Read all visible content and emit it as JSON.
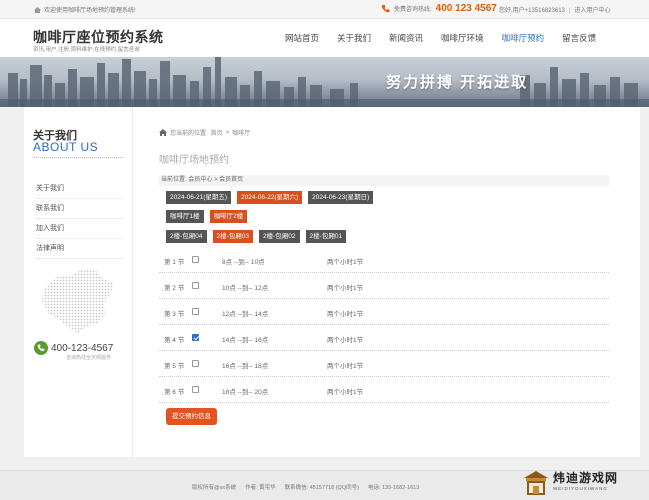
{
  "topbar": {
    "welcome": "欢迎使用咖啡厅场地预约管理系统!",
    "hotline_label": "免费咨询热线:",
    "hotline_number": "400 123 4567",
    "user_text": "您好,用户+13516823613",
    "user_links": "进入用户中心"
  },
  "header": {
    "title": "咖啡厅座位预约系统",
    "subtitle": "资讯,用户,注册,资料维护,在线预约,留言咨询",
    "nav": [
      {
        "label": "网站首页",
        "active": false
      },
      {
        "label": "关于我们",
        "active": false
      },
      {
        "label": "新闻资讯",
        "active": false
      },
      {
        "label": "咖啡厅环境",
        "active": false
      },
      {
        "label": "咖啡厅预约",
        "active": true
      },
      {
        "label": "留言反馈",
        "active": false
      }
    ]
  },
  "banner": {
    "slogan": "努力拼搏 开拓进取"
  },
  "sidebar": {
    "title_cn": "关于我们",
    "title_en": "ABOUT US",
    "menu": [
      "关于我们",
      "联系我们",
      "加入我们",
      "法律声明"
    ],
    "phone": "400-123-4567",
    "phone_caption": "咨询热线全天候服务"
  },
  "main": {
    "breadcrumb": [
      "您当前的位置:",
      "首页",
      ">",
      "咖啡厅"
    ],
    "page_title": "咖啡厅场地预约",
    "location": "当前位置:  会员中心  >  会员首页",
    "dates": [
      {
        "label": "2024-06-21(星期五)",
        "selected": false
      },
      {
        "label": "2024-06-22(星期六)",
        "selected": true
      },
      {
        "label": "2024-06-23(星期日)",
        "selected": false
      }
    ],
    "halls": [
      {
        "label": "咖啡厅1楼",
        "selected": false
      },
      {
        "label": "咖啡厅2楼",
        "selected": true
      }
    ],
    "rooms": [
      {
        "label": "2楼-包厢04",
        "selected": false
      },
      {
        "label": "2楼-包厢03",
        "selected": true
      },
      {
        "label": "2楼-包厢02",
        "selected": false
      },
      {
        "label": "2楼-包厢01",
        "selected": false
      }
    ],
    "slots": [
      {
        "name": "第 1 节",
        "time": "8点 --到-- 10点",
        "duration": "两个小时1节",
        "checked": false
      },
      {
        "name": "第 2 节",
        "time": "10点 --到-- 12点",
        "duration": "两个小时1节",
        "checked": false
      },
      {
        "name": "第 3 节",
        "time": "12点 --到-- 14点",
        "duration": "两个小时1节",
        "checked": false
      },
      {
        "name": "第 4 节",
        "time": "14点 --到-- 16点",
        "duration": "两个小时1节",
        "checked": true
      },
      {
        "name": "第 5 节",
        "time": "16点 --到-- 18点",
        "duration": "两个小时1节",
        "checked": false
      },
      {
        "name": "第 6 节",
        "time": "18点 --到-- 20点",
        "duration": "两个小时1节",
        "checked": false
      }
    ],
    "submit_label": "提交预约信息"
  },
  "footer": {
    "copyright": "版权所有@xx系统",
    "author": "作者: 黄宅华",
    "contact": "联系微信: 45157718 (QQ同号)",
    "phone": "电话: 135-1682-1613"
  },
  "watermark": {
    "cn": "炜迪游戏网",
    "en": "WEIDIYOUXIWANG"
  },
  "colors": {
    "accent": "#2a6fc9",
    "selected": "#d9501e",
    "chip": "#555555",
    "hotline": "#e65c00"
  }
}
